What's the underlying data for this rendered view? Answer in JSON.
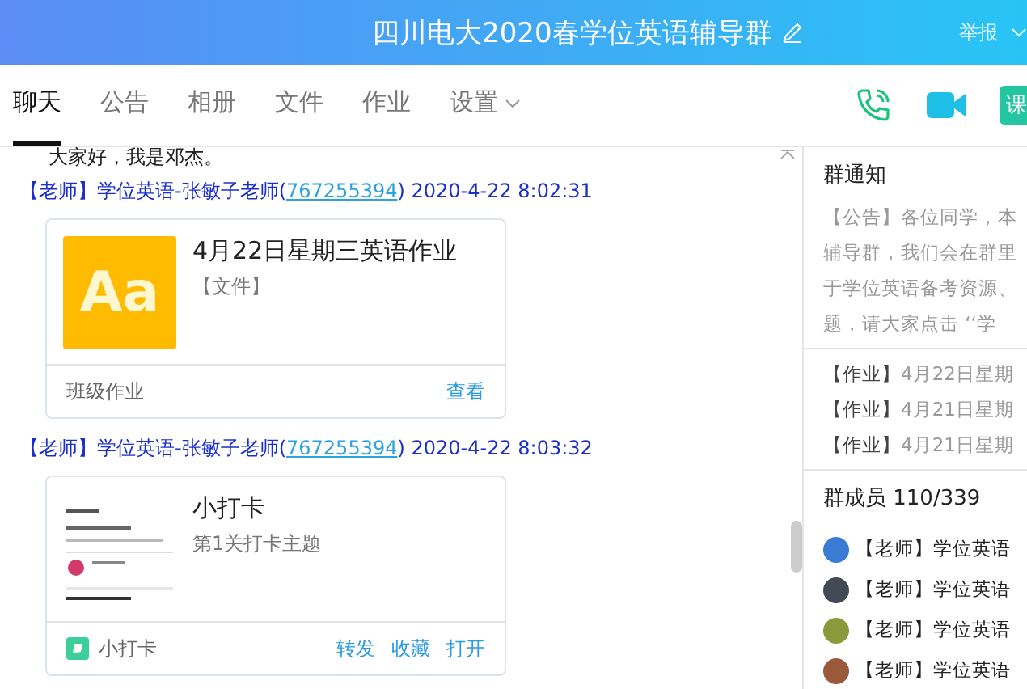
{
  "header": {
    "title": "四川电大2020春学位英语辅导群",
    "report": "举报"
  },
  "tabs": [
    {
      "label": "聊天",
      "selected": true,
      "dropdown": false
    },
    {
      "label": "公告",
      "selected": false,
      "dropdown": false
    },
    {
      "label": "相册",
      "selected": false,
      "dropdown": false
    },
    {
      "label": "文件",
      "selected": false,
      "dropdown": false
    },
    {
      "label": "作业",
      "selected": false,
      "dropdown": false
    },
    {
      "label": "设置",
      "selected": false,
      "dropdown": true
    }
  ],
  "toolbar": {
    "partial_button": "课"
  },
  "chat": {
    "top_text": "大家好，我是邓杰。",
    "messages": [
      {
        "role": "【老师】",
        "sender": "学位英语-张敏子老师(",
        "qq": "767255394",
        "close": ")",
        "time": "2020-4-22 8:02:31",
        "card": {
          "kind": "file",
          "logo": "Aa",
          "title": "4月22日星期三英语作业",
          "subtitle": "【文件】",
          "footer": "班级作业",
          "actions": [
            "查看"
          ]
        }
      },
      {
        "role": "【老师】",
        "sender": "学位英语-张敏子老师(",
        "qq": "767255394",
        "close": ")",
        "time": "2020-4-22 8:03:32",
        "card": {
          "kind": "miniapp",
          "title": "小打卡",
          "subtitle": "第1关打卡主题",
          "footer": "小打卡",
          "actions": [
            "转发",
            "收藏",
            "打开"
          ]
        }
      }
    ]
  },
  "notice": {
    "title": "群通知",
    "lines": [
      "【公告】各位同学，本",
      "辅导群，我们会在群里",
      "于学位英语备考资源、",
      "题，请大家点击 ‘‘学"
    ],
    "homework": [
      {
        "tag": "【作业】",
        "text": "4月22日星期"
      },
      {
        "tag": "【作业】",
        "text": "4月21日星期"
      },
      {
        "tag": "【作业】",
        "text": "4月21日星期"
      }
    ]
  },
  "members": {
    "title": "群成员 110/339",
    "items": [
      {
        "name": "【老师】学位英语",
        "color": "#3a7bd5"
      },
      {
        "name": "【老师】学位英语",
        "color": "#444a55"
      },
      {
        "name": "【老师】学位英语",
        "color": "#8a9a3a"
      },
      {
        "name": "【老师】学位英语",
        "color": "#9a5a3a"
      }
    ]
  }
}
